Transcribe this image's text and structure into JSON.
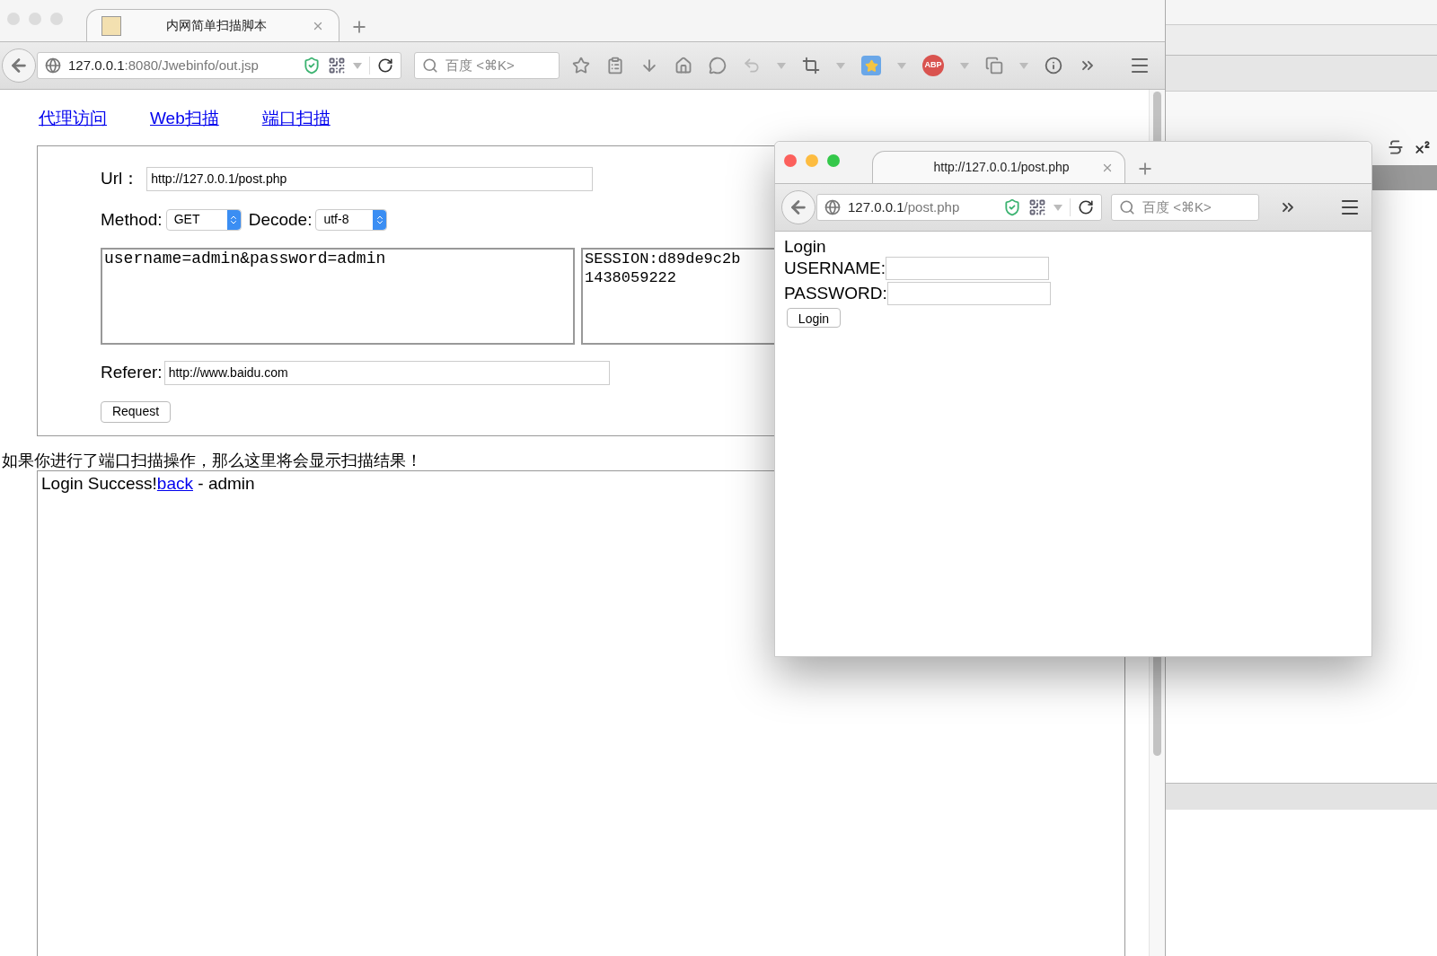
{
  "main_window": {
    "tab": {
      "title": "内网简单扫描脚本"
    },
    "address": {
      "host": "127.0.0.1",
      "path": ":8080/Jwebinfo/out.jsp"
    },
    "search": {
      "placeholder": "百度 <⌘K>"
    },
    "adblock_badge": "ABP"
  },
  "page": {
    "nav_links": [
      "代理访问",
      "Web扫描",
      "端口扫描"
    ],
    "form": {
      "url_label": "Url：",
      "url_value": "http://127.0.0.1/post.php",
      "method_label": "Method:",
      "method_value": "GET",
      "decode_label": "Decode:",
      "decode_value": "utf-8",
      "post_body": "username=admin&password=admin",
      "cookie_lines": [
        "SESSION:d89de9c2b",
        "1438059222"
      ],
      "referer_label": "Referer:",
      "referer_value": "http://www.baidu.com",
      "request_button": "Request"
    },
    "result_notice": "如果你进行了端口扫描操作，那么这里将会显示扫描结果！",
    "result": {
      "text": "Login Success!",
      "link": "back",
      "suffix": " - admin"
    }
  },
  "popup_window": {
    "tab": {
      "title": "http://127.0.0.1/post.php"
    },
    "address": {
      "host": "127.0.0.1",
      "path": "/post.php"
    },
    "search": {
      "placeholder": "百度 <⌘K>"
    },
    "page": {
      "heading": "Login",
      "fields": [
        {
          "label": "USERNAME:"
        },
        {
          "label": "PASSWORD:"
        }
      ],
      "button": "Login"
    }
  }
}
